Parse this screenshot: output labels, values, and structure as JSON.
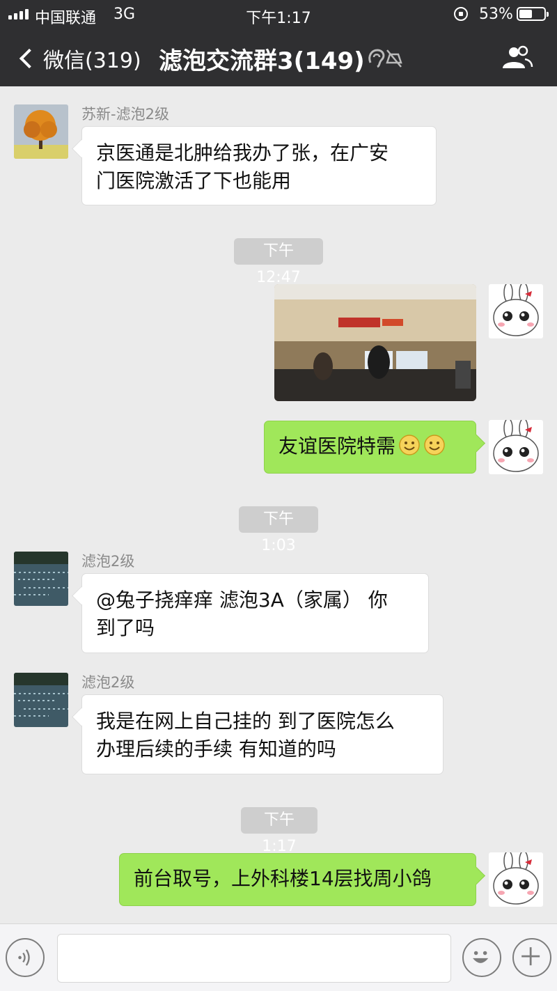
{
  "status_bar": {
    "carrier": "中国联通",
    "network": "3G",
    "time": "下午1:17",
    "battery": "53%",
    "battery_level": 0.53
  },
  "nav": {
    "back_label": "微信(319)",
    "title": "滤泡交流群3(149)",
    "back_icon": "chevron-left-icon",
    "earpiece_icon": "earpiece-muted-icon",
    "members_icon": "group-members-icon"
  },
  "messages": [
    {
      "sender": "苏新-滤泡2级",
      "text": "京医通是北肿给我办了张，在广安门医院激活了下也能用",
      "line1": "京医通是北肿给我办了张，在广安",
      "line2": "门医院激活了下也能用"
    },
    {
      "time": "下午12:47"
    },
    {
      "type": "image",
      "from": "me"
    },
    {
      "text": "友谊医院特需",
      "emoji": [
        "smile-emoji",
        "smile-emoji"
      ],
      "from": "me"
    },
    {
      "time": "下午1:03"
    },
    {
      "sender": "滤泡2级",
      "line1": "@兔子挠痒痒 滤泡3A（家属） 你",
      "line2": "到了吗"
    },
    {
      "sender": "滤泡2级",
      "line1": "我是在网上自己挂的 到了医院怎么",
      "line2": "办理后续的手续 有知道的吗"
    },
    {
      "time": "下午1:17"
    },
    {
      "text": "前台取号，上外科楼14层找周小鸽",
      "from": "me"
    }
  ],
  "colors": {
    "topbar": "#2f2f31",
    "background": "#ebebeb",
    "outgoing_bubble": "#a0e75a",
    "incoming_bubble": "#ffffff",
    "time_chip": "#cecece"
  },
  "input_bar": {
    "voice_icon": "voice-icon",
    "emoji_icon": "emoji-icon",
    "plus_icon": "plus-icon"
  }
}
